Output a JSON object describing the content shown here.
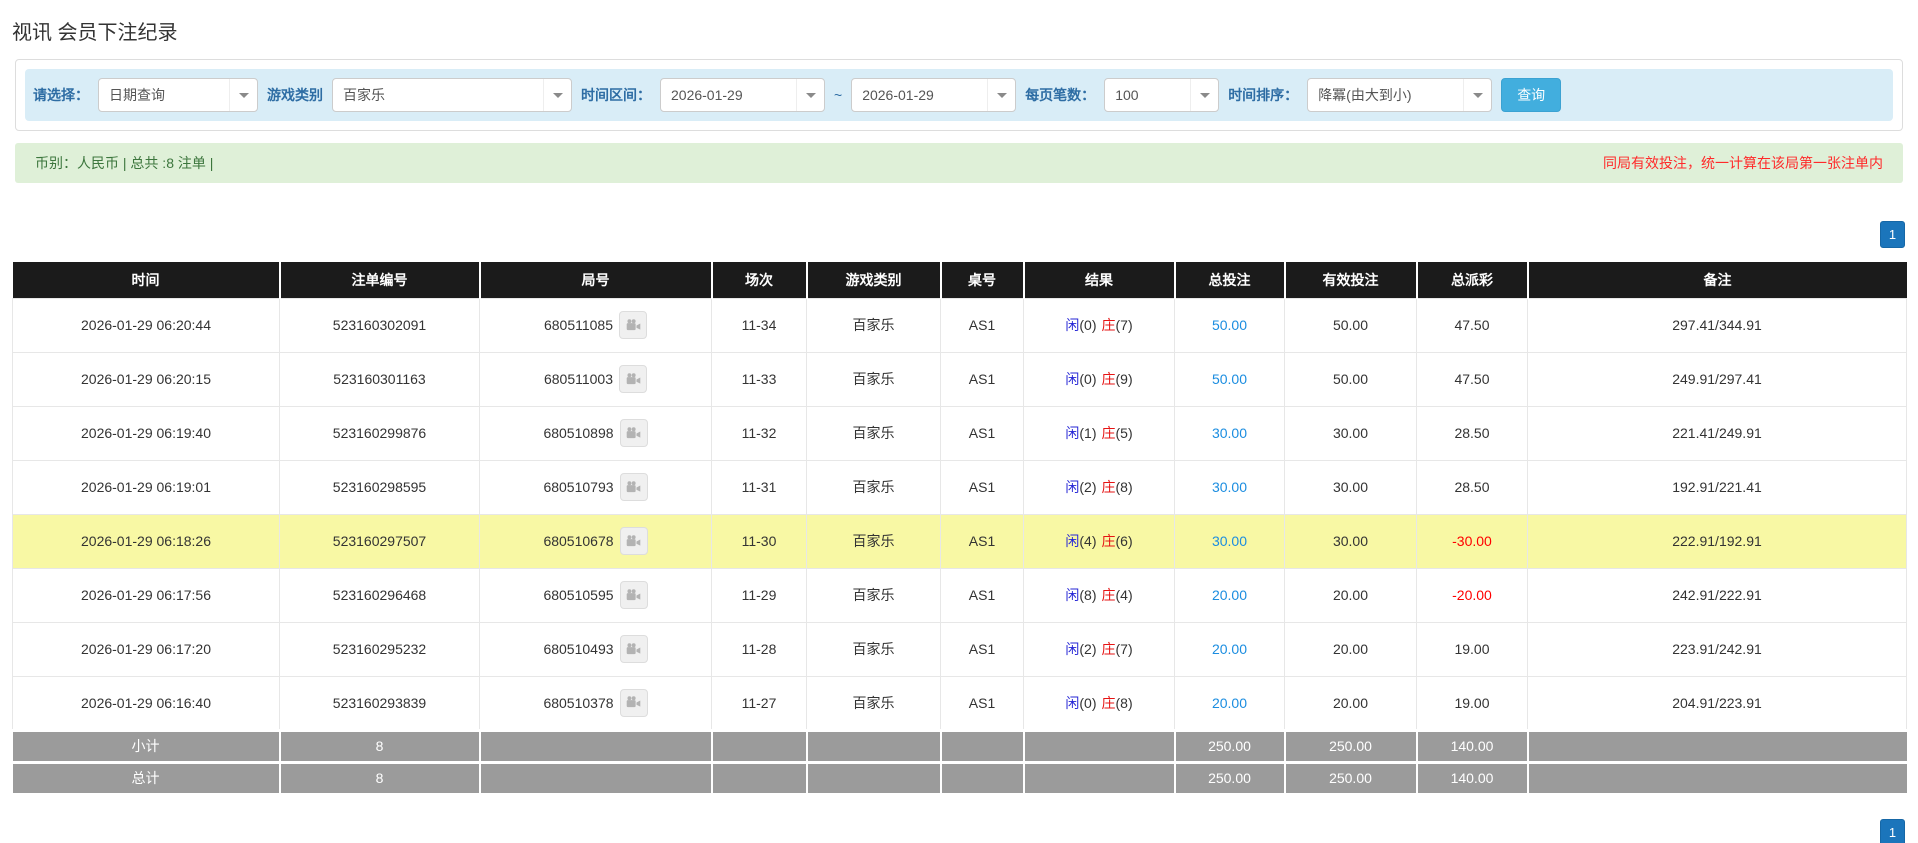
{
  "page": {
    "title": "视讯 会员下注纪录"
  },
  "filters": {
    "select_label": "请选择：",
    "select_value": "日期查询",
    "game_label": "游戏类别",
    "game_value": "百家乐",
    "range_label": "时间区间：",
    "date_from": "2026-01-29",
    "tilde": "~",
    "date_to": "2026-01-29",
    "page_size_label": "每页笔数：",
    "page_size_value": "100",
    "sort_label": "时间排序：",
    "sort_value": "降冪(由大到小)",
    "query_button": "查询"
  },
  "summary": {
    "left": "币别：人民币 | 总共 :8 注单 |",
    "right": "同局有效投注，统一计算在该局第一张注单内"
  },
  "pagination": {
    "page": "1"
  },
  "table": {
    "headers": [
      "时间",
      "注单编号",
      "局号",
      "场次",
      "游戏类别",
      "桌号",
      "结果",
      "总投注",
      "有效投注",
      "总派彩",
      "备注"
    ],
    "result_labels": {
      "player": "闲",
      "banker": "庄"
    },
    "rows": [
      {
        "time": "2026-01-29 06:20:44",
        "bet_no": "523160302091",
        "round_no": "680511085",
        "session": "11-34",
        "game": "百家乐",
        "table_no": "AS1",
        "player_score": "(0)",
        "banker_score": "(7)",
        "total_bet": "50.00",
        "valid_bet": "50.00",
        "payout": "47.50",
        "remark": "297.41/344.91",
        "highlight": false
      },
      {
        "time": "2026-01-29 06:20:15",
        "bet_no": "523160301163",
        "round_no": "680511003",
        "session": "11-33",
        "game": "百家乐",
        "table_no": "AS1",
        "player_score": "(0)",
        "banker_score": "(9)",
        "total_bet": "50.00",
        "valid_bet": "50.00",
        "payout": "47.50",
        "remark": "249.91/297.41",
        "highlight": false
      },
      {
        "time": "2026-01-29 06:19:40",
        "bet_no": "523160299876",
        "round_no": "680510898",
        "session": "11-32",
        "game": "百家乐",
        "table_no": "AS1",
        "player_score": "(1)",
        "banker_score": "(5)",
        "total_bet": "30.00",
        "valid_bet": "30.00",
        "payout": "28.50",
        "remark": "221.41/249.91",
        "highlight": false
      },
      {
        "time": "2026-01-29 06:19:01",
        "bet_no": "523160298595",
        "round_no": "680510793",
        "session": "11-31",
        "game": "百家乐",
        "table_no": "AS1",
        "player_score": "(2)",
        "banker_score": "(8)",
        "total_bet": "30.00",
        "valid_bet": "30.00",
        "payout": "28.50",
        "remark": "192.91/221.41",
        "highlight": false
      },
      {
        "time": "2026-01-29 06:18:26",
        "bet_no": "523160297507",
        "round_no": "680510678",
        "session": "11-30",
        "game": "百家乐",
        "table_no": "AS1",
        "player_score": "(4)",
        "banker_score": "(6)",
        "total_bet": "30.00",
        "valid_bet": "30.00",
        "payout": "-30.00",
        "remark": "222.91/192.91",
        "highlight": true
      },
      {
        "time": "2026-01-29 06:17:56",
        "bet_no": "523160296468",
        "round_no": "680510595",
        "session": "11-29",
        "game": "百家乐",
        "table_no": "AS1",
        "player_score": "(8)",
        "banker_score": "(4)",
        "total_bet": "20.00",
        "valid_bet": "20.00",
        "payout": "-20.00",
        "remark": "242.91/222.91",
        "highlight": false
      },
      {
        "time": "2026-01-29 06:17:20",
        "bet_no": "523160295232",
        "round_no": "680510493",
        "session": "11-28",
        "game": "百家乐",
        "table_no": "AS1",
        "player_score": "(2)",
        "banker_score": "(7)",
        "total_bet": "20.00",
        "valid_bet": "20.00",
        "payout": "19.00",
        "remark": "223.91/242.91",
        "highlight": false
      },
      {
        "time": "2026-01-29 06:16:40",
        "bet_no": "523160293839",
        "round_no": "680510378",
        "session": "11-27",
        "game": "百家乐",
        "table_no": "AS1",
        "player_score": "(0)",
        "banker_score": "(8)",
        "total_bet": "20.00",
        "valid_bet": "20.00",
        "payout": "19.00",
        "remark": "204.91/223.91",
        "highlight": false
      }
    ],
    "subtotal": {
      "label": "小计",
      "count": "8",
      "total_bet": "250.00",
      "valid_bet": "250.00",
      "payout": "140.00"
    },
    "total": {
      "label": "总计",
      "count": "8",
      "total_bet": "250.00",
      "valid_bet": "250.00",
      "payout": "140.00"
    }
  },
  "colors": {
    "accent-blue": "#42aede",
    "label-blue": "#2e6da4",
    "filter-bar-bg": "#d9edf7",
    "summary-bg": "#dff0d8",
    "summary-text": "#3c763d",
    "warning-red": "#ff2a2a",
    "pagination-blue": "#1b75bb",
    "header-bg": "#1b1b1b",
    "highlight-yellow": "#f8f8a4",
    "link-blue": "#1b8de0",
    "player-blue": "#2626d6",
    "banker-red": "#e61414",
    "negative-red": "#ff0000",
    "footer-gray": "#9b9b9b"
  }
}
